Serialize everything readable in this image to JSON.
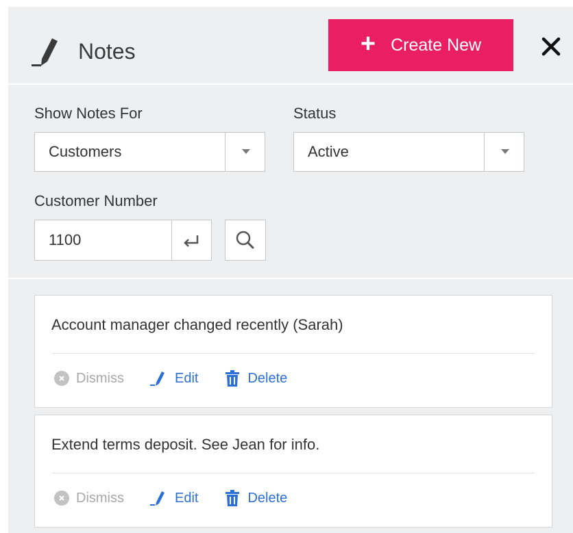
{
  "header": {
    "title": "Notes",
    "create_label": "Create New",
    "create_color": "#e91e63"
  },
  "filters": {
    "show_notes_for_label": "Show Notes For",
    "show_notes_for_value": "Customers",
    "status_label": "Status",
    "status_value": "Active",
    "customer_number_label": "Customer Number",
    "customer_number_value": "1100"
  },
  "notes": [
    {
      "text": "Account manager changed recently (Sarah)",
      "dismiss_label": "Dismiss",
      "edit_label": "Edit",
      "delete_label": "Delete"
    },
    {
      "text": "Extend terms deposit. See Jean for info.",
      "dismiss_label": "Dismiss",
      "edit_label": "Edit",
      "delete_label": "Delete"
    }
  ],
  "icons": {
    "title": "pencil-icon",
    "create": "plus-icon",
    "close": "close-icon",
    "dropdown": "chevron-down-icon",
    "enter": "enter-icon",
    "search": "search-icon",
    "dismiss": "dismiss-icon",
    "edit": "pencil-icon",
    "delete": "trash-icon"
  },
  "colors": {
    "panel_bg": "#eeeff1",
    "link": "#2d6fd4",
    "muted": "#a8a8a8"
  }
}
